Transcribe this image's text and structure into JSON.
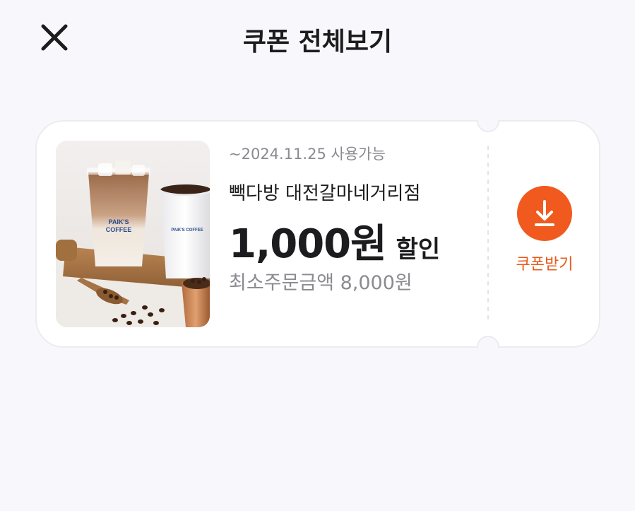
{
  "header": {
    "title": "쿠폰 전체보기",
    "close_icon": "close-icon"
  },
  "coupon": {
    "expiry": "~2024.11.25 사용가능",
    "store": "빽다방 대전갈마네거리점",
    "amount": "1,000원",
    "discount_word": "할인",
    "min_order": "최소주문금액 8,000원",
    "download_label": "쿠폰받기",
    "download_icon": "download-icon",
    "image": {
      "cup_text_1": "PAIK'S",
      "cup_text_2": "COFFEE",
      "cup_text_3": "PAIK'S COFFEE"
    }
  },
  "colors": {
    "accent": "#f05a1e",
    "accent_text": "#e85a1a",
    "background": "#f8f8fc",
    "card": "#ffffff",
    "muted_text": "#8a8a90",
    "primary_text": "#1c1c1e"
  }
}
